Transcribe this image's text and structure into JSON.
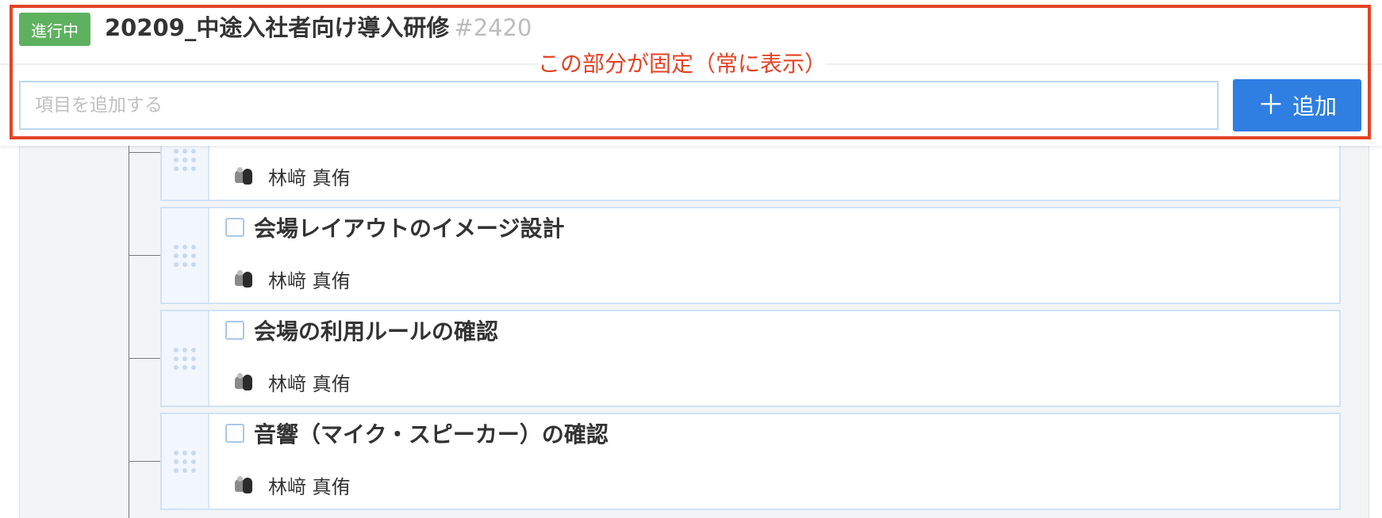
{
  "header": {
    "status_badge": "進行中",
    "project_title": "20209_中途入社者向け導入研修",
    "project_id": "#2420",
    "input_placeholder": "項目を追加する",
    "add_button_label": "追加",
    "add_button_icon": "plus-icon"
  },
  "annotation": {
    "text": "この部分が固定（常に表示）",
    "color": "#e34326"
  },
  "tasks": [
    {
      "title": "",
      "assignee": "林﨑 真侑",
      "checked": false
    },
    {
      "title": "会場レイアウトのイメージ設計",
      "assignee": "林﨑 真侑",
      "checked": false
    },
    {
      "title": "会場の利用ルールの確認",
      "assignee": "林﨑 真侑",
      "checked": false
    },
    {
      "title": "音響（マイク・スピーカー）の確認",
      "assignee": "林﨑 真侑",
      "checked": false
    }
  ],
  "colors": {
    "status_badge": "#5eb15e",
    "add_button": "#2f7ee2",
    "annotation": "#e34326",
    "card_border": "#cfe2f7"
  }
}
